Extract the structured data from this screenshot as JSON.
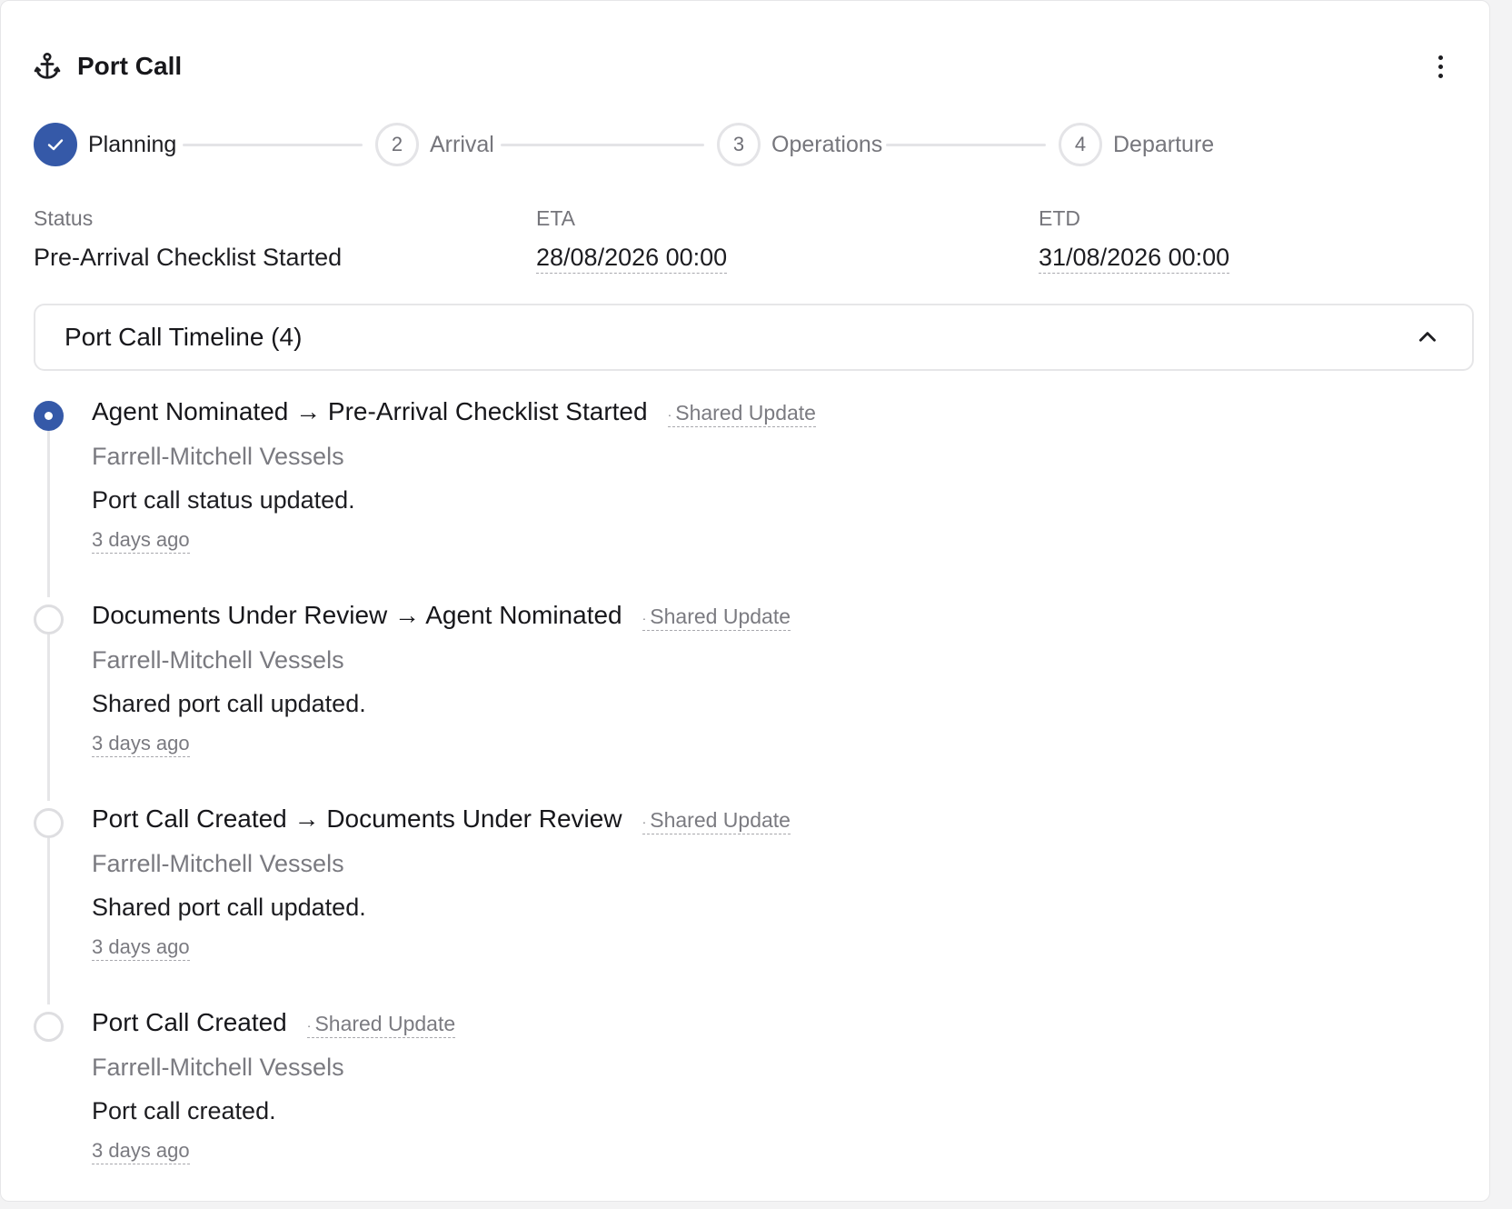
{
  "header": {
    "title": "Port Call",
    "icon": "anchor-icon",
    "menu_icon": "more-vertical-icon"
  },
  "colors": {
    "accent": "#3559a8",
    "muted_text": "#76767c",
    "border": "#e6e6e8"
  },
  "stepper": {
    "steps": [
      {
        "label": "Planning",
        "number": "1",
        "state": "done",
        "icon": "check-icon"
      },
      {
        "label": "Arrival",
        "number": "2",
        "state": "pending"
      },
      {
        "label": "Operations",
        "number": "3",
        "state": "pending"
      },
      {
        "label": "Departure",
        "number": "4",
        "state": "pending"
      }
    ]
  },
  "summary": {
    "status_label": "Status",
    "status_value": "Pre-Arrival Checklist Started",
    "eta_label": "ETA",
    "eta_value": "28/08/2026 00:00",
    "etd_label": "ETD",
    "etd_value": "31/08/2026 00:00"
  },
  "timeline": {
    "title": "Port Call Timeline (4)",
    "collapse_icon": "chevron-up-icon",
    "entries": [
      {
        "title": "Agent Nominated → Pre-Arrival Checklist Started",
        "badge": "Shared Update",
        "org": "Farrell-Mitchell Vessels",
        "message": "Port call status updated.",
        "ago": "3 days ago",
        "current": true
      },
      {
        "title": "Documents Under Review → Agent Nominated",
        "badge": "Shared Update",
        "org": "Farrell-Mitchell Vessels",
        "message": "Shared port call updated.",
        "ago": "3 days ago",
        "current": false
      },
      {
        "title": "Port Call Created → Documents Under Review",
        "badge": "Shared Update",
        "org": "Farrell-Mitchell Vessels",
        "message": "Shared port call updated.",
        "ago": "3 days ago",
        "current": false
      },
      {
        "title": "Port Call Created",
        "badge": "Shared Update",
        "org": "Farrell-Mitchell Vessels",
        "message": "Port call created.",
        "ago": "3 days ago",
        "current": false
      }
    ]
  }
}
